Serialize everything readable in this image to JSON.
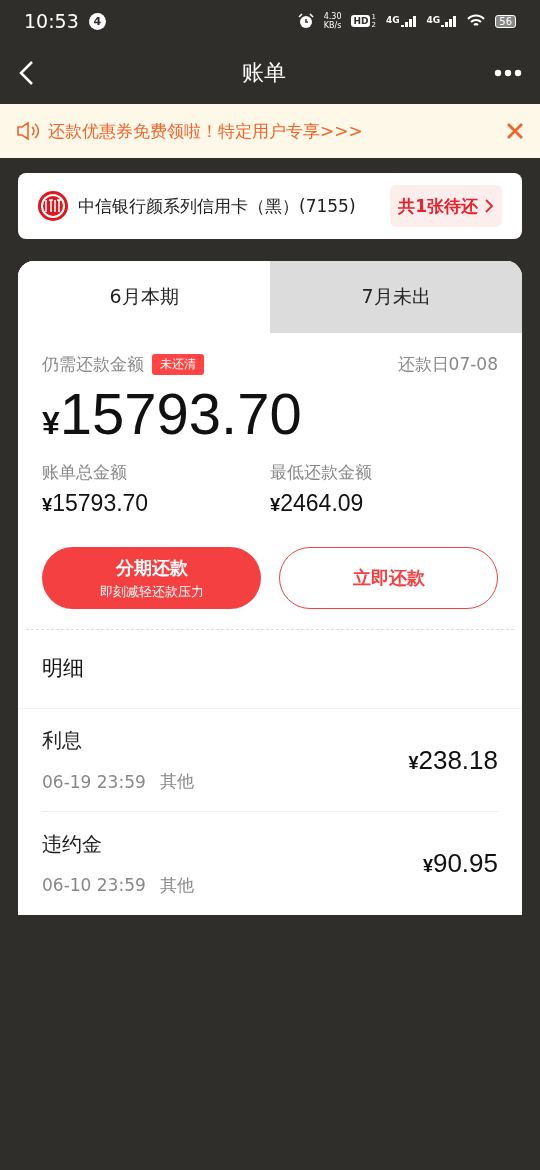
{
  "status_bar": {
    "time": "10:53",
    "notification_count": "4",
    "net_speed": "4.30",
    "net_unit": "KB/s",
    "hd": {
      "label": "HD",
      "sims": [
        "1",
        "2"
      ]
    },
    "signals": [
      "4G",
      "4G"
    ],
    "battery": "56"
  },
  "nav": {
    "title": "账单"
  },
  "notice": {
    "text": "还款优惠券免费领啦！特定用户专享>>>"
  },
  "card": {
    "name": "中信银行颜系列信用卡（黑）(7155)",
    "pending": "共1张待还"
  },
  "tabs": [
    {
      "label": "6月本期",
      "selected": true
    },
    {
      "label": "7月未出",
      "selected": false
    }
  ],
  "summary": {
    "label": "仍需还款金额",
    "badge": "未还清",
    "due": "还款日07-08",
    "currency": "¥",
    "amount": "15793.70",
    "stats": [
      {
        "label": "账单总金额",
        "currency": "¥",
        "value": "15793.70"
      },
      {
        "label": "最低还款金额",
        "currency": "¥",
        "value": "2464.09"
      }
    ]
  },
  "buttons": [
    {
      "kind": "primary",
      "label": "分期还款",
      "sub": "即刻减轻还款压力"
    },
    {
      "kind": "outline",
      "label": "立即还款"
    }
  ],
  "details": {
    "title": "明细",
    "rows": [
      {
        "name": "利息",
        "time": "06-19 23:59",
        "type": "其他",
        "currency": "¥",
        "amount": "238.18"
      },
      {
        "name": "违约金",
        "time": "06-10 23:59",
        "type": "其他",
        "currency": "¥",
        "amount": "90.95"
      }
    ]
  }
}
